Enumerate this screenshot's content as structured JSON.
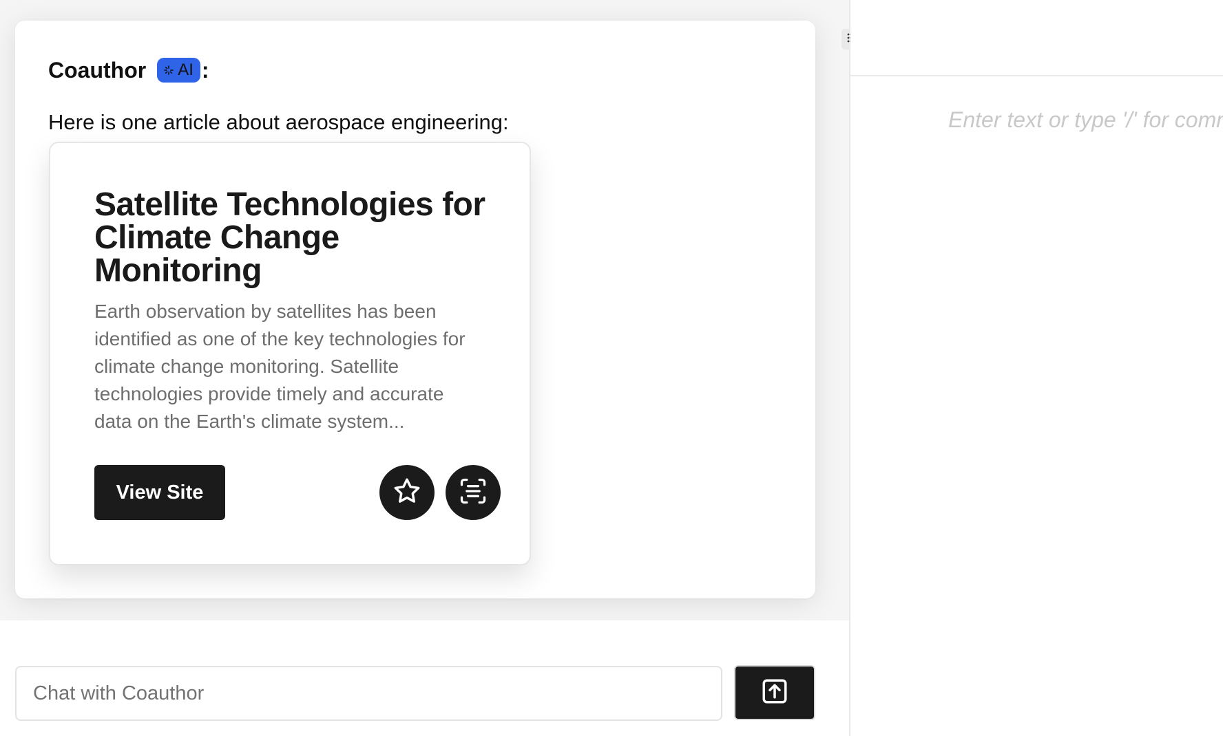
{
  "chat": {
    "author": "Coauthor",
    "ai_badge": {
      "icon": "sparkle-icon",
      "label": "AI",
      "color": "#2f63e8"
    },
    "colon": ":",
    "message": "Here is one article about aerospace engineering:",
    "article": {
      "title": "Satellite Technologies for Climate Change Monitoring",
      "description": "Earth observation by satellites has been identified as one of the key technologies for climate change monitoring. Satellite technologies provide timely and accurate data on the Earth's climate system...",
      "view_site_label": "View Site",
      "favorite_icon": "star-icon",
      "summarize_icon": "summary-scan-icon"
    },
    "composer": {
      "placeholder": "Chat with Coauthor",
      "value": "",
      "send_icon": "upload-arrow-icon"
    }
  },
  "editor": {
    "placeholder": "Enter text or type '/' for commands"
  },
  "colors": {
    "button_dark": "#1b1b1b",
    "badge_blue": "#2f63e8",
    "muted_text": "#6e6e6e",
    "placeholder_gray": "#c8c8c8"
  }
}
